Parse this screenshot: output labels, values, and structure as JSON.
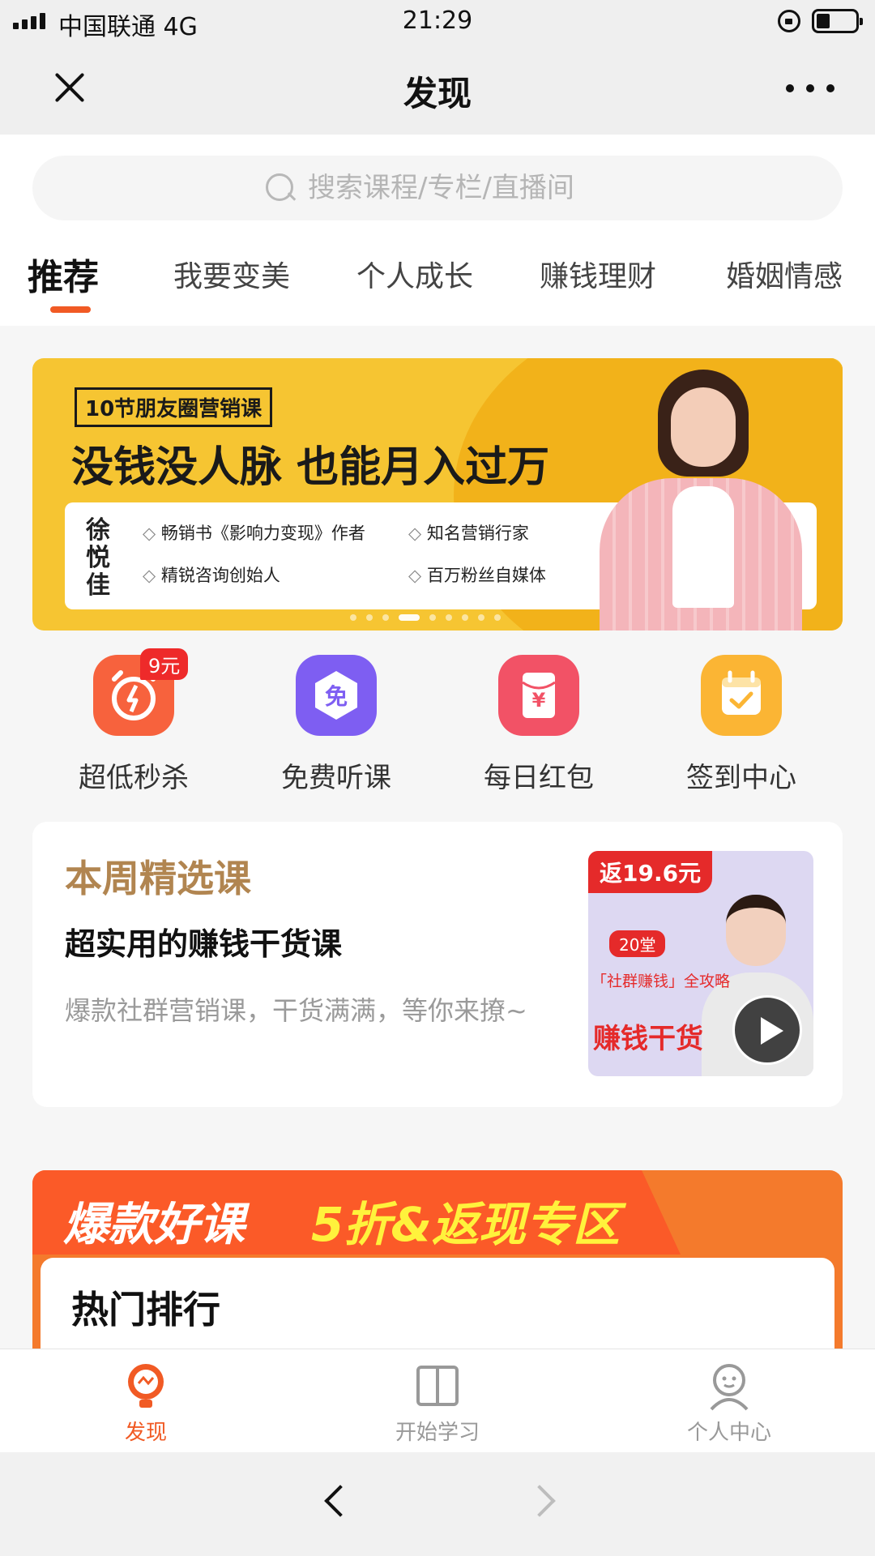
{
  "status": {
    "carrier": "中国联通 4G",
    "time": "21:29"
  },
  "nav": {
    "title": "发现"
  },
  "search": {
    "placeholder": "搜索课程/专栏/直播间"
  },
  "tabs": [
    {
      "label": "推荐"
    },
    {
      "label": "我要变美"
    },
    {
      "label": "个人成长"
    },
    {
      "label": "赚钱理财"
    },
    {
      "label": "婚姻情感"
    }
  ],
  "banner": {
    "tag": "10节朋友圈营销课",
    "title": "没钱没人脉  也能月入过万",
    "name": "徐悦佳",
    "points": [
      "畅销书《影响力变现》作者",
      "知名营销行家",
      "精锐咨询创始人",
      "百万粉丝自媒体"
    ]
  },
  "quick": [
    {
      "label": "超低秒杀",
      "badge": "9元",
      "icon": "alarm-clock-icon",
      "color": "#f7623d"
    },
    {
      "label": "免费听课",
      "glyph": "免",
      "icon": "free-badge-icon",
      "color": "#7e5ef2"
    },
    {
      "label": "每日红包",
      "glyph": "¥",
      "icon": "red-envelope-icon",
      "color": "#f25266"
    },
    {
      "label": "签到中心",
      "icon": "calendar-check-icon",
      "color": "#fbb534"
    }
  ],
  "featured": {
    "heading": "本周精选课",
    "title": "超实用的赚钱干货课",
    "desc": "爆款社群营销课，干货满满，等你来撩~",
    "thumb": {
      "return": "返19.6元",
      "pill": "20堂",
      "sub": "「社群赚钱」全攻略",
      "big": "赚钱干货"
    }
  },
  "hot": {
    "label1": "爆款好课",
    "label2": "5折&返现专区",
    "title": "热门排行"
  },
  "tabbar": [
    {
      "label": "发现",
      "icon": "discover-bulb-icon"
    },
    {
      "label": "开始学习",
      "icon": "open-book-icon"
    },
    {
      "label": "个人中心",
      "icon": "person-icon"
    }
  ],
  "colors": {
    "accent": "#f15a24",
    "banner": "#f6c532",
    "featuredHeading": "#b18550"
  }
}
